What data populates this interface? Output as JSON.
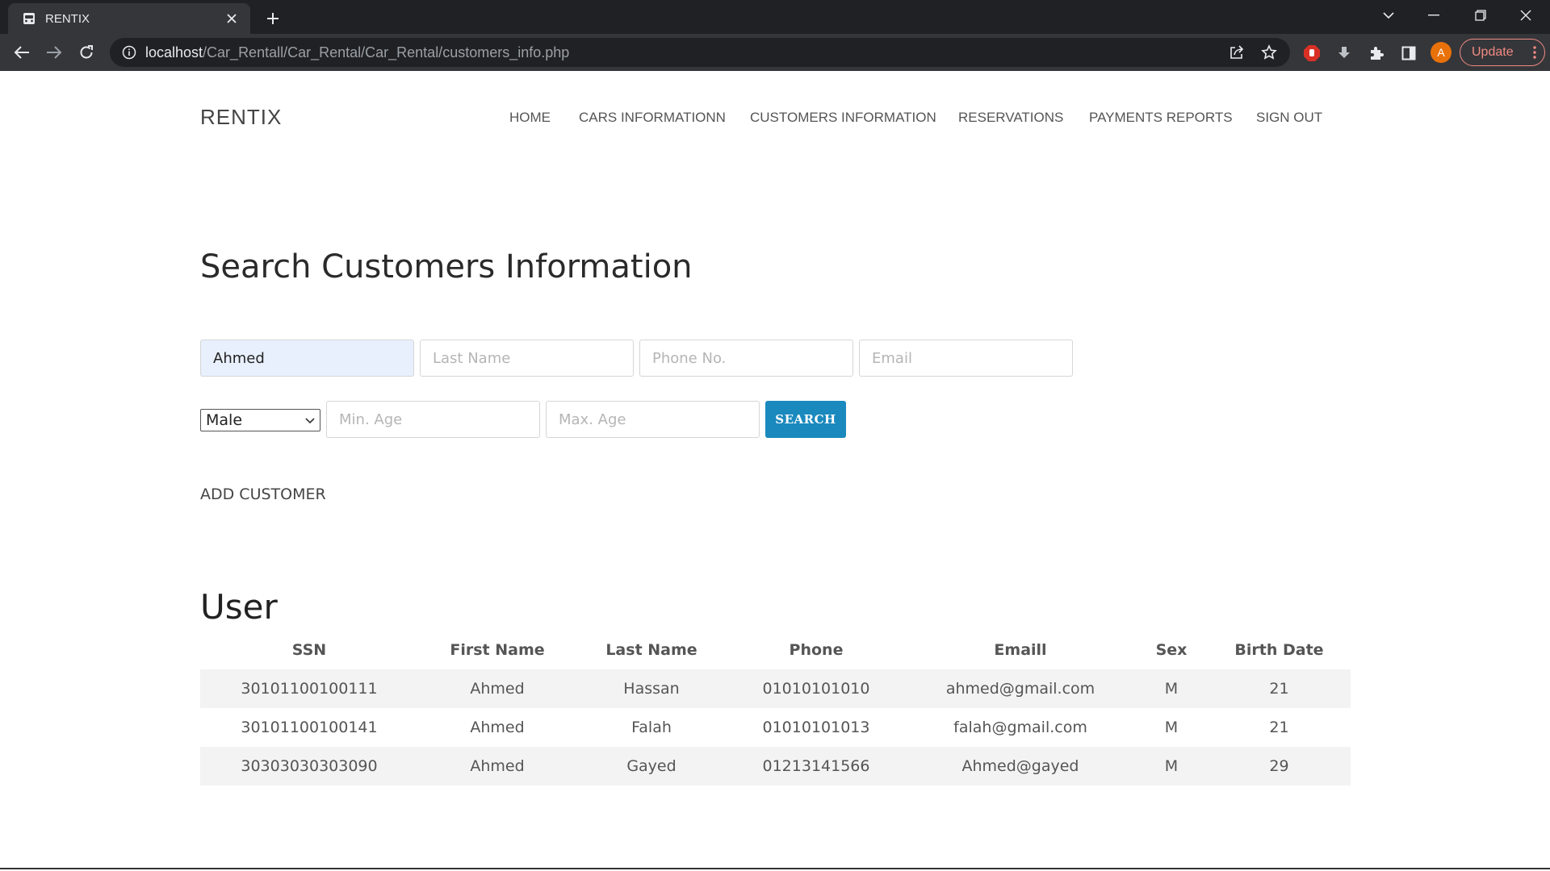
{
  "browser": {
    "tab_title": "RENTIX",
    "url_host": "localhost",
    "url_path": "/Car_Rentall/Car_Rental/Car_Rental/customers_info.php",
    "profile_initial": "A",
    "update_label": "Update",
    "accent_color": "#e8710a"
  },
  "site": {
    "brand": "RENTIX",
    "nav": [
      {
        "label": "HOME"
      },
      {
        "label": "CARS INFORMATIONN"
      },
      {
        "label": "CUSTOMERS INFORMATION"
      },
      {
        "label": "RESERVATIONS"
      },
      {
        "label": "PAYMENTS REPORTS"
      },
      {
        "label": "SIGN OUT"
      }
    ]
  },
  "search": {
    "heading": "Search Customers Information",
    "first_name_value": "Ahmed",
    "last_name_placeholder": "Last Name",
    "phone_placeholder": "Phone No.",
    "email_placeholder": "Email",
    "sex_selected": "Male",
    "min_age_placeholder": "Min. Age",
    "max_age_placeholder": "Max. Age",
    "search_label": "SEARCH",
    "button_color": "#1a89be"
  },
  "add_customer_label": "ADD CUSTOMER",
  "users": {
    "heading": "User",
    "columns": [
      "SSN",
      "First Name",
      "Last Name",
      "Phone",
      "Emaill",
      "Sex",
      "Birth Date"
    ],
    "rows": [
      [
        "30101100100111",
        "Ahmed",
        "Hassan",
        "01010101010",
        "ahmed@gmail.com",
        "M",
        "21"
      ],
      [
        "30101100100141",
        "Ahmed",
        "Falah",
        "01010101013",
        "falah@gmail.com",
        "M",
        "21"
      ],
      [
        "30303030303090",
        "Ahmed",
        "Gayed",
        "01213141566",
        "Ahmed@gayed",
        "M",
        "29"
      ]
    ]
  }
}
